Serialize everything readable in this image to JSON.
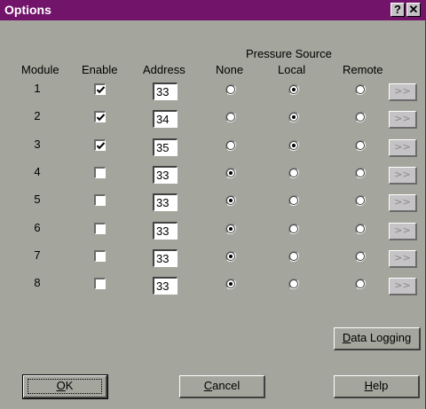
{
  "window": {
    "title": "Options"
  },
  "titlebar_buttons": {
    "help": "?",
    "close": "✕"
  },
  "group_label": "Pressure Source",
  "headers": {
    "module": "Module",
    "enable": "Enable",
    "address": "Address",
    "none": "None",
    "local": "Local",
    "remote": "Remote"
  },
  "rows": [
    {
      "module": "1",
      "enabled": true,
      "address": "33",
      "source": "local"
    },
    {
      "module": "2",
      "enabled": true,
      "address": "34",
      "source": "local"
    },
    {
      "module": "3",
      "enabled": true,
      "address": "35",
      "source": "local"
    },
    {
      "module": "4",
      "enabled": false,
      "address": "33",
      "source": "none"
    },
    {
      "module": "5",
      "enabled": false,
      "address": "33",
      "source": "none"
    },
    {
      "module": "6",
      "enabled": false,
      "address": "33",
      "source": "none"
    },
    {
      "module": "7",
      "enabled": false,
      "address": "33",
      "source": "none"
    },
    {
      "module": "8",
      "enabled": false,
      "address": "33",
      "source": "none"
    }
  ],
  "more_button_label": ">>",
  "buttons": {
    "data_logging": {
      "mnemonic": "D",
      "rest": "ata Logging"
    },
    "ok": {
      "mnemonic": "O",
      "rest": "K"
    },
    "cancel": {
      "mnemonic": "C",
      "rest": "ancel"
    },
    "help": {
      "mnemonic": "H",
      "rest": "elp"
    }
  },
  "colors": {
    "titlebar": "#73146b",
    "dialog_bg": "#a4a59c",
    "disabled_text": "#8a8a8a"
  }
}
